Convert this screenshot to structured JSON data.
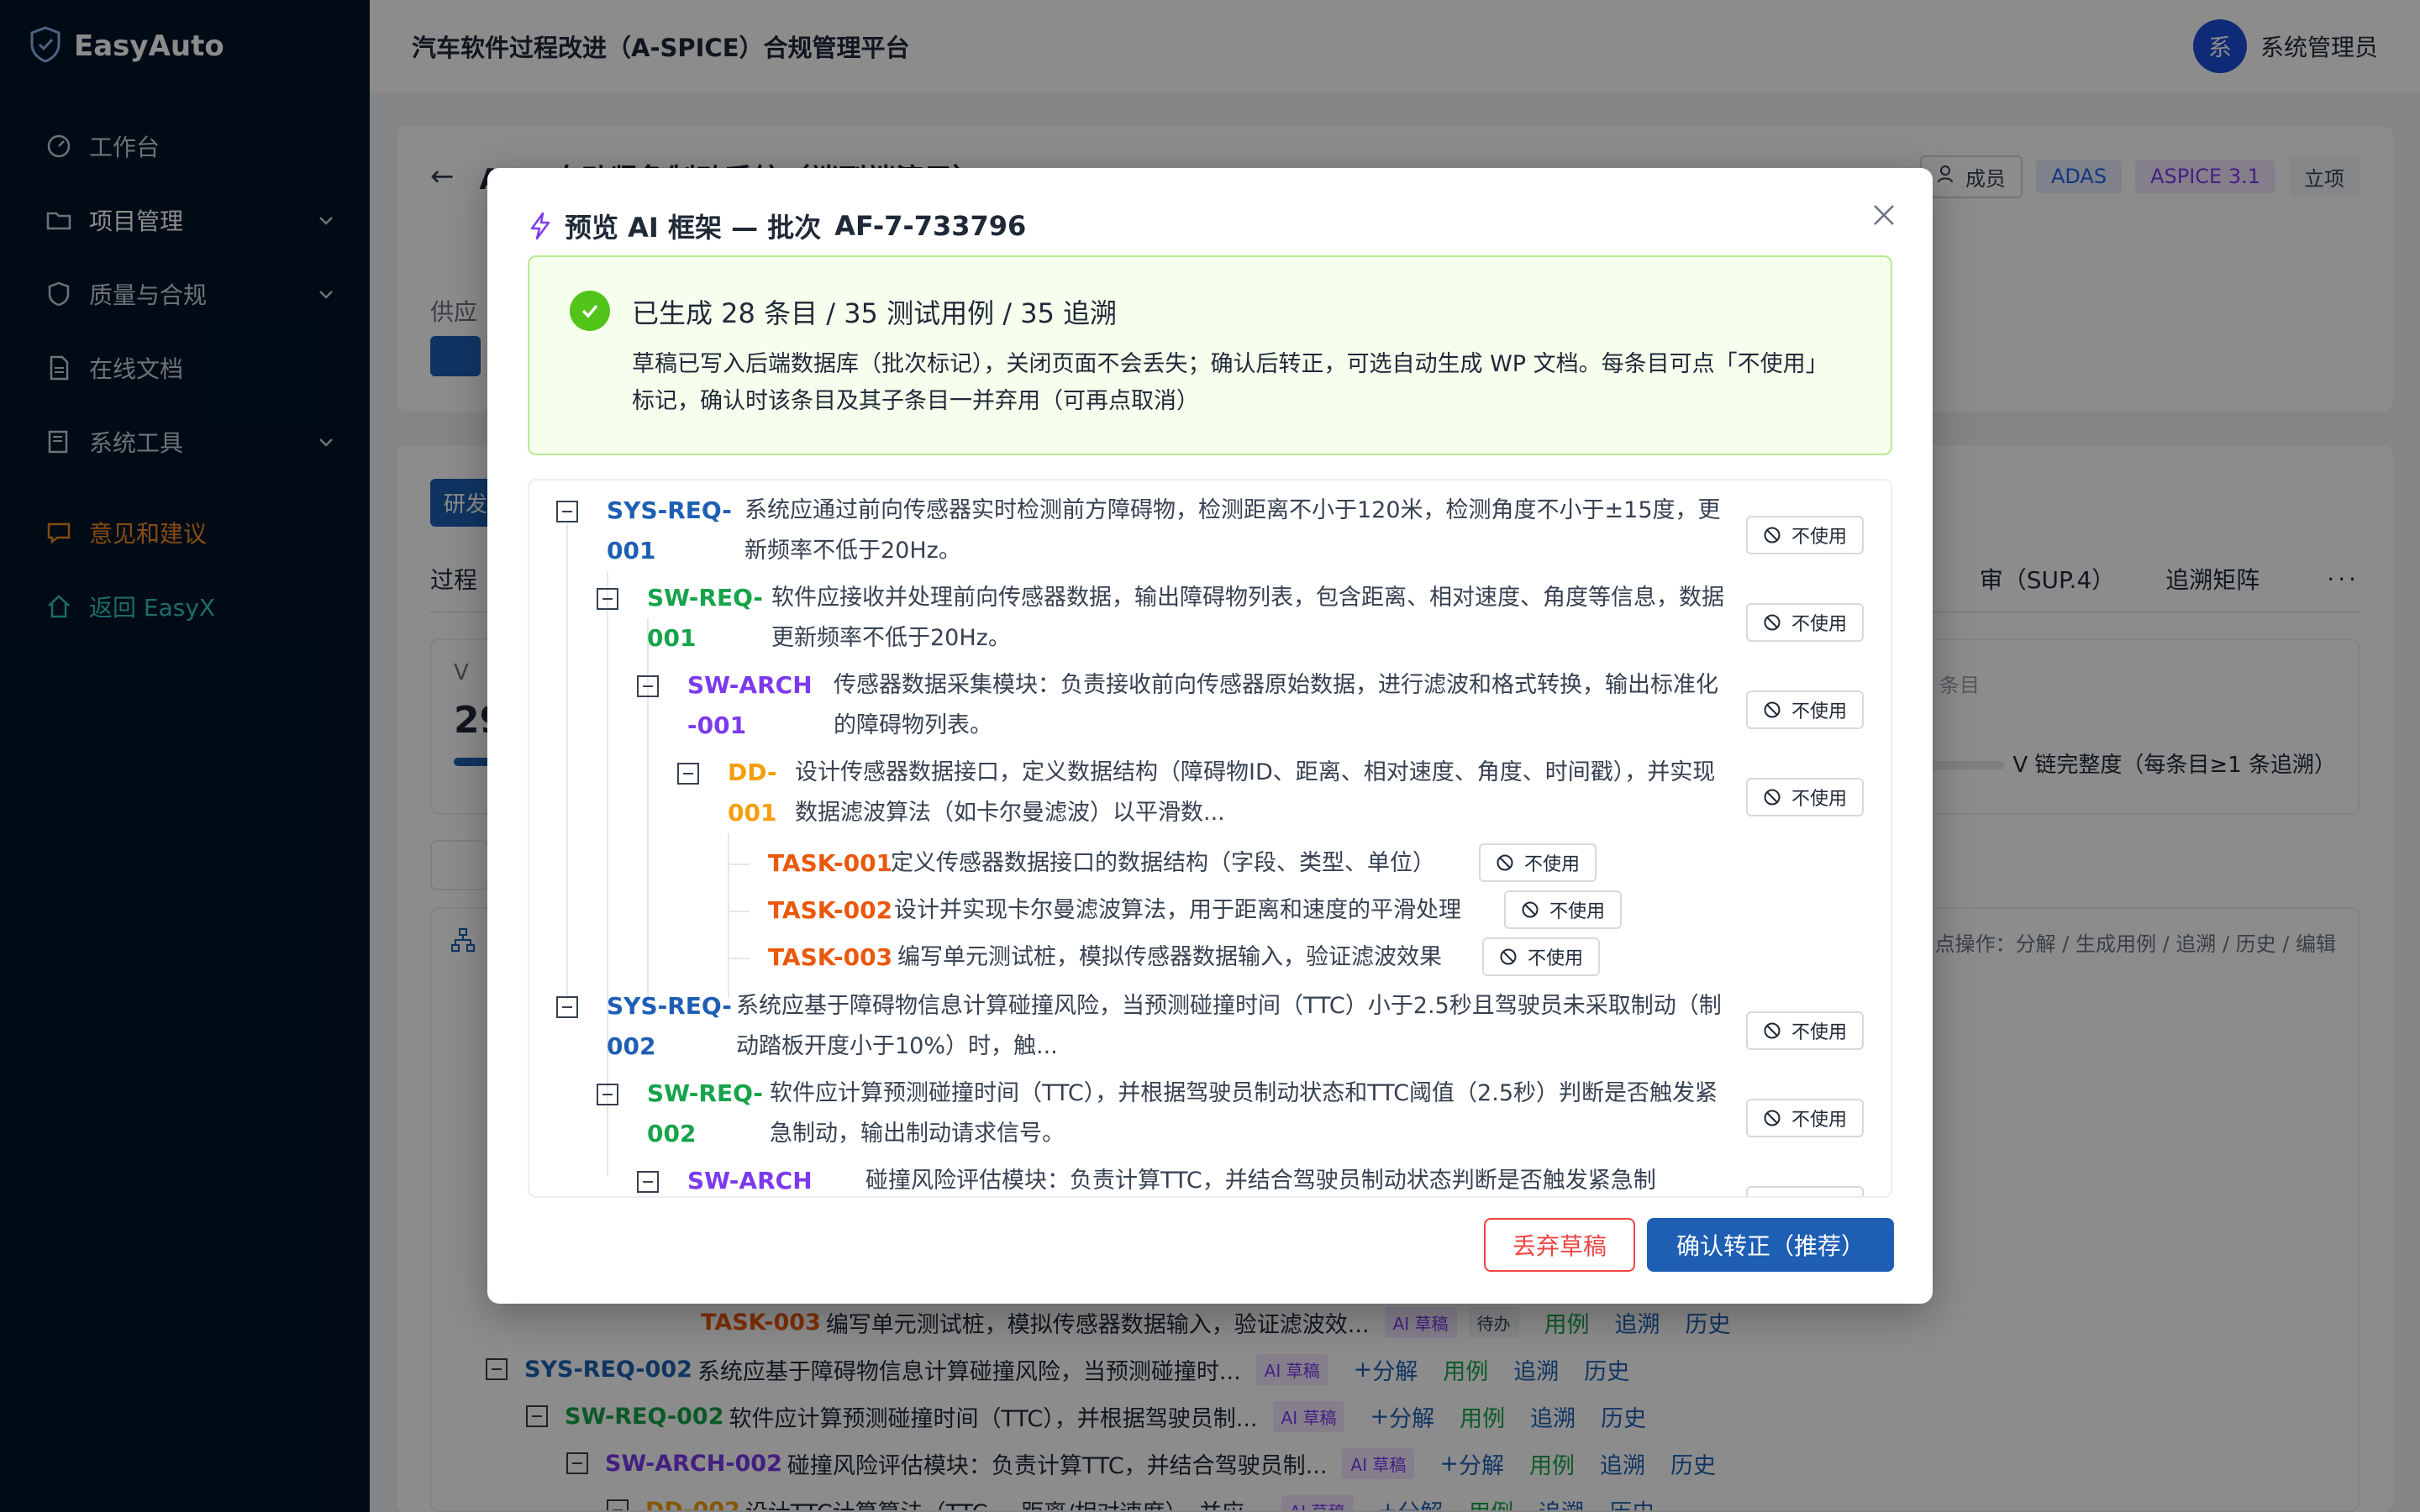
{
  "app": {
    "logo_text": "EasyAuto",
    "title": "汽车软件过程改进（A-SPICE）合规管理平台",
    "user_avatar": "系",
    "user_name": "系统管理员"
  },
  "sidebar": {
    "items": [
      {
        "label": "工作台",
        "icon": "dashboard-icon"
      },
      {
        "label": "项目管理",
        "icon": "folder-icon",
        "expandable": true
      },
      {
        "label": "质量与合规",
        "icon": "shield-icon",
        "expandable": true
      },
      {
        "label": "在线文档",
        "icon": "document-icon"
      },
      {
        "label": "系统工具",
        "icon": "tools-icon",
        "expandable": true
      },
      {
        "label": "意见和建议",
        "icon": "chat-icon",
        "color": "#f08a24"
      },
      {
        "label": "返回 EasyX",
        "icon": "home-icon",
        "color": "#35c5c0"
      }
    ]
  },
  "project": {
    "name": "AEB 自动紧急制动系统（端到端演示）",
    "member_label": "成员",
    "tags": [
      "ADAS",
      "ASPICE 3.1",
      "立项"
    ],
    "supply_label": "供应",
    "rd_label": "研发",
    "tab_first": "过程",
    "tabs": [
      "审（SUP.4）",
      "追溯矩阵"
    ],
    "more": "···",
    "stats_v": "V",
    "stats_num": "29",
    "stats_items_label": "条目",
    "chain_label": "V 链完整度（每条目≥1 条追溯）",
    "tree_hint": "点操作：分解 / 生成用例 / 追溯 / 历史 / 编辑"
  },
  "bg_tree": {
    "ai_tag": "AI 草稿",
    "pending_tag": "待办",
    "actions": {
      "decompose": "分解",
      "case": "用例",
      "trace": "追溯",
      "history": "历史"
    },
    "rows": [
      {
        "code": "TASK-003",
        "text": "编写单元测试桩，模拟传感器数据输入，验证滤波效...",
        "kind": "task"
      },
      {
        "code": "SYS-REQ-002",
        "text": "系统应基于障碍物信息计算碰撞风险，当预测碰撞时...",
        "kind": "sys"
      },
      {
        "code": "SW-REQ-002",
        "text": "软件应计算预测碰撞时间（TTC），并根据驾驶员制...",
        "kind": "sw"
      },
      {
        "code": "SW-ARCH-002",
        "text": "碰撞风险评估模块：负责计算TTC，并结合驾驶员制...",
        "kind": "arch"
      },
      {
        "code": "DD-002",
        "text": "设计TTC计算算法（TTC = 距离/相对速度），并应...",
        "kind": "dd"
      }
    ]
  },
  "modal": {
    "title": "预览 AI 框架 — 批次",
    "batch_id": "AF-7-733796",
    "success_title": "已生成 28 条目 / 35 测试用例 / 35 追溯",
    "success_desc": "草稿已写入后端数据库（批次标记），关闭页面不会丢失；确认后转正，可选自动生成 WP 文档。每条目可点「不使用」标记，确认时该条目及其子条目一并弃用（可再点取消）",
    "no_use_label": "不使用",
    "discard_label": "丢弃草稿",
    "confirm_label": "确认转正（推荐）",
    "items": [
      {
        "code": "SYS-REQ-001",
        "text": "系统应通过前向传感器实时检测前方障碍物，检测距离不小于120米，检测角度不小于±15度，更新频率不低于20Hz。"
      },
      {
        "code": "SW-REQ-001",
        "text": "软件应接收并处理前向传感器数据，输出障碍物列表，包含距离、相对速度、角度等信息，数据更新频率不低于20Hz。"
      },
      {
        "code": "SW-ARCH-001",
        "text": "传感器数据采集模块：负责接收前向传感器原始数据，进行滤波和格式转换，输出标准化的障碍物列表。"
      },
      {
        "code": "DD-001",
        "text": "设计传感器数据接口，定义数据结构（障碍物ID、距离、相对速度、角度、时间戳），并实现数据滤波算法（如卡尔曼滤波）以平滑数..."
      },
      {
        "code": "TASK-001",
        "text": "定义传感器数据接口的数据结构（字段、类型、单位）"
      },
      {
        "code": "TASK-002",
        "text": "设计并实现卡尔曼滤波算法，用于距离和速度的平滑处理"
      },
      {
        "code": "TASK-003",
        "text": "编写单元测试桩，模拟传感器数据输入，验证滤波效果"
      },
      {
        "code": "SYS-REQ-002",
        "text": "系统应基于障碍物信息计算碰撞风险，当预测碰撞时间（TTC）小于2.5秒且驾驶员未采取制动（制动踏板开度小于10%）时，触..."
      },
      {
        "code": "SW-REQ-002",
        "text": "软件应计算预测碰撞时间（TTC），并根据驾驶员制动状态和TTC阈值（2.5秒）判断是否触发紧急制动，输出制动请求信号。"
      },
      {
        "code": "SW-ARCH-",
        "text": "碰撞风险评估模块：负责计算TTC，并结合驾驶员制动状态判断是否触发紧急制"
      }
    ]
  }
}
